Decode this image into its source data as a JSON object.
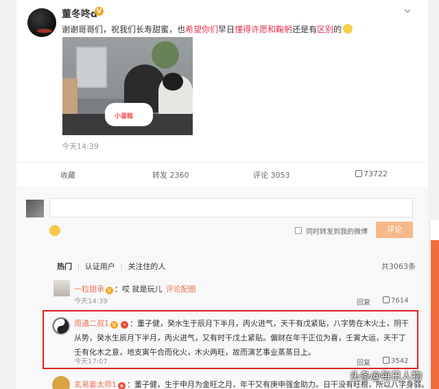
{
  "post": {
    "username": "董冬咚d",
    "vip_badge": "V",
    "text_parts": [
      "谢谢哥哥们，祝我们长寿甜蜜，也",
      "希望你们",
      "早日",
      "懂得许愿和鞠躬",
      "还是有",
      "区别",
      "的"
    ],
    "photo_caption": "小蛋糕",
    "time": "今天14:39",
    "actions": {
      "favorite": "收藏",
      "repost": "转发 2360",
      "comment": "评论 3053",
      "like": "73722"
    }
  },
  "comment_box": {
    "placeholder": "",
    "forward_label": "同时转发到我的微博",
    "submit_label": "评论"
  },
  "tabs": {
    "hot": "热门",
    "verified": "认证用户",
    "followed": "关注住的人",
    "total": "共3063条"
  },
  "comments": [
    {
      "name": "一粒甜承",
      "text": "：哎 就是玩儿",
      "link": "评论配图",
      "time": "今天14:39",
      "reply": "回复",
      "likes": "7614"
    },
    {
      "name": "周通二叔1",
      "text": "：董子健，癸水生于辰月下半月，丙火进气，天干有戊紧贴，八字势在木火土，阴干从势，癸水生辰月下半月，丙火进气，又有时干戊土紧贴。偏财在年干正位为喜，壬寅大运，天干丁壬有化木之意，地支寅午合而化火，木火两旺，故而演艺事业蒸蒸日上。",
      "time": "今天17:07",
      "reply": "回复",
      "likes": "3542"
    },
    {
      "name": "玄易姜太师1",
      "text": "：董子健，生于申月为金旺之月，年干又有庚申强金助力。日干没有旺根，所以八字身弱。"
    }
  ],
  "watermark": "头条@每日人物"
}
